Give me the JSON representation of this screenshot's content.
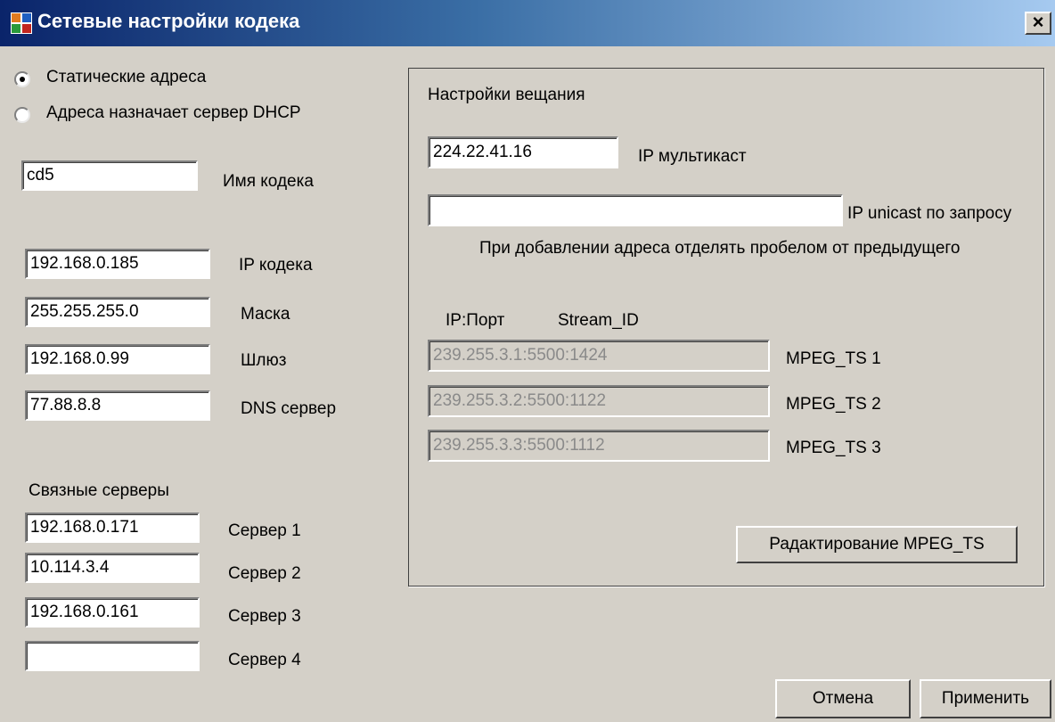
{
  "window": {
    "title": "Сетевые настройки кодека",
    "close_symbol": "×",
    "icon": "app-window-icon"
  },
  "address_mode": {
    "options": [
      {
        "label": "Статические адреса",
        "checked": true
      },
      {
        "label": "Адреса назначает сервер DHCP",
        "checked": false
      }
    ]
  },
  "codec": {
    "name_value": "cd5",
    "name_label": "Имя кодека",
    "ip_value": "192.168.0.185",
    "ip_label": "IP кодека",
    "mask_value": "255.255.255.0",
    "mask_label": "Маска",
    "gateway_value": "192.168.0.99",
    "gateway_label": "Шлюз",
    "dns_value": "77.88.8.8",
    "dns_label": "DNS сервер"
  },
  "servers": {
    "heading": "Связные серверы",
    "items": [
      {
        "value": "192.168.0.171",
        "label": "Сервер 1"
      },
      {
        "value": "10.114.3.4",
        "label": "Сервер 2"
      },
      {
        "value": "192.168.0.161",
        "label": "Сервер 3"
      },
      {
        "value": "",
        "label": "Сервер 4"
      }
    ]
  },
  "broadcast": {
    "title": "Настройки вещания",
    "multicast_value": "224.22.41.16",
    "multicast_label": "IP мультикаст",
    "unicast_value": "",
    "unicast_label": "IP unicast по запросу",
    "hint": "При добавлении адреса  отделять пробелом от предыдущего",
    "col_ip_port": "IP:Порт",
    "col_stream_id": "Stream_ID",
    "streams": [
      {
        "value": "239.255.3.1:5500:1424",
        "label": "MPEG_TS 1"
      },
      {
        "value": "239.255.3.2:5500:1122",
        "label": "MPEG_TS 2"
      },
      {
        "value": "239.255.3.3:5500:1112",
        "label": "MPEG_TS 3"
      }
    ],
    "edit_button": "Радактирование  MPEG_TS"
  },
  "footer": {
    "cancel_label": "Отмена",
    "apply_label": "Применить"
  },
  "colors": {
    "title_gradient_start": "#0a246a",
    "title_gradient_end": "#a6caf0",
    "window_bg": "#d4d0c8",
    "disabled_text": "#8a8a8a"
  }
}
